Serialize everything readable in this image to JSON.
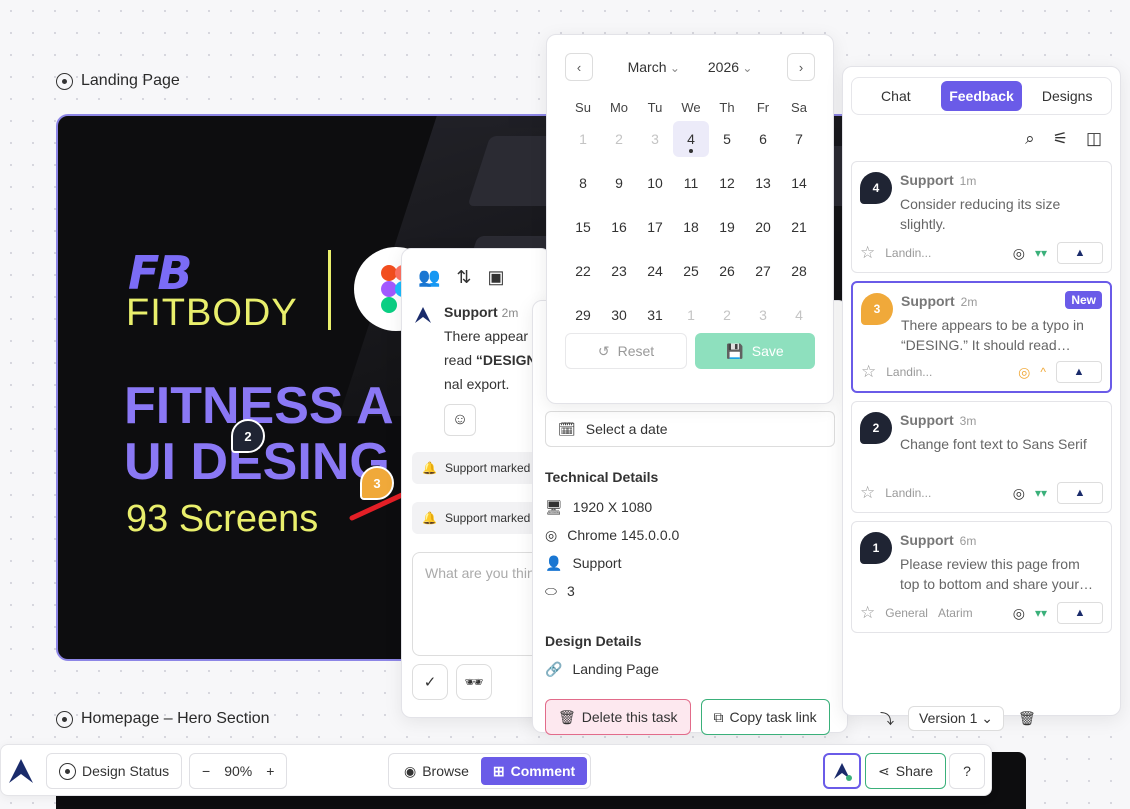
{
  "sections": {
    "landing_title": "Landing Page",
    "homepage_title": "Homepage – Hero Section"
  },
  "hero": {
    "logo_mark": "FB",
    "logo_word_bold": "FIT",
    "logo_word_light": "BODY",
    "headline_1": "FITNESS A",
    "headline_2": "UI DESING",
    "sub": "93 Screens"
  },
  "canvas_pins": [
    {
      "number": "2",
      "color": "#1f2433"
    },
    {
      "number": "3",
      "color": "#f0a93a"
    }
  ],
  "comment_panel": {
    "author": "Support",
    "time": "2m",
    "body_line1": "There appear",
    "body_line2_prefix": "read ",
    "body_line2_bold": "“DESIGN",
    "body_line3": "nal export.",
    "pill_1": "Support marked",
    "pill_2": "Support marked",
    "compose_placeholder": "What are you thin"
  },
  "calendar": {
    "month": "March",
    "year": "2026",
    "weekdays": [
      "Su",
      "Mo",
      "Tu",
      "We",
      "Th",
      "Fr",
      "Sa"
    ],
    "days": [
      {
        "d": "1",
        "muted": true
      },
      {
        "d": "2",
        "muted": true
      },
      {
        "d": "3",
        "muted": true
      },
      {
        "d": "4",
        "today": true
      },
      {
        "d": "5"
      },
      {
        "d": "6"
      },
      {
        "d": "7"
      },
      {
        "d": "8"
      },
      {
        "d": "9"
      },
      {
        "d": "10"
      },
      {
        "d": "11"
      },
      {
        "d": "12"
      },
      {
        "d": "13"
      },
      {
        "d": "14"
      },
      {
        "d": "15"
      },
      {
        "d": "16"
      },
      {
        "d": "17"
      },
      {
        "d": "18"
      },
      {
        "d": "19"
      },
      {
        "d": "20"
      },
      {
        "d": "21"
      },
      {
        "d": "22"
      },
      {
        "d": "23"
      },
      {
        "d": "24"
      },
      {
        "d": "25"
      },
      {
        "d": "26"
      },
      {
        "d": "27"
      },
      {
        "d": "28"
      },
      {
        "d": "29"
      },
      {
        "d": "30"
      },
      {
        "d": "31"
      },
      {
        "d": "1",
        "muted": true
      },
      {
        "d": "2",
        "muted": true
      },
      {
        "d": "3",
        "muted": true
      },
      {
        "d": "4",
        "muted": true
      }
    ],
    "reset_label": "Reset",
    "save_label": "Save"
  },
  "task_details": {
    "date_placeholder": "Select a date",
    "technical_title": "Technical Details",
    "resolution": "1920 X 1080",
    "browser": "Chrome 145.0.0.0",
    "user": "Support",
    "number": "3",
    "design_title": "Design Details",
    "page": "Landing Page",
    "delete_label": "Delete this task",
    "copy_label": "Copy task link"
  },
  "feedback_panel": {
    "tabs": [
      "Chat",
      "Feedback",
      "Designs"
    ],
    "active_tab": "Feedback",
    "items": [
      {
        "pin": "4",
        "pin_color": "#1f2433",
        "author": "Support",
        "time": "1m",
        "message": "Consider reducing its size slightly.",
        "page": "Landin...",
        "extra": "",
        "new": false,
        "status": "▾▾"
      },
      {
        "pin": "3",
        "pin_color": "#f0a93a",
        "author": "Support",
        "time": "2m",
        "message": "There appears to be a typo in “DESING.” It should read…",
        "page": "Landin...",
        "extra": "",
        "new": true,
        "status": "^"
      },
      {
        "pin": "2",
        "pin_color": "#1f2433",
        "author": "Support",
        "time": "3m",
        "message": "Change font text to Sans Serif",
        "page": "Landin...",
        "extra": "",
        "new": false,
        "status": "▾▾"
      },
      {
        "pin": "1",
        "pin_color": "#1f2433",
        "author": "Support",
        "time": "6m",
        "message": "Please review this page from top to bottom and share your…",
        "page": "General",
        "extra": "Atarim",
        "new": false,
        "status": "▾▾"
      }
    ],
    "new_badge": "New"
  },
  "bottom_bar": {
    "design_status": "Design Status",
    "zoom": "90%",
    "browse": "Browse",
    "comment": "Comment",
    "share": "Share",
    "version": "Version 1"
  },
  "colors": {
    "accent": "#6a5be8",
    "lime": "#e9ef6c",
    "green": "#3ab07a"
  }
}
